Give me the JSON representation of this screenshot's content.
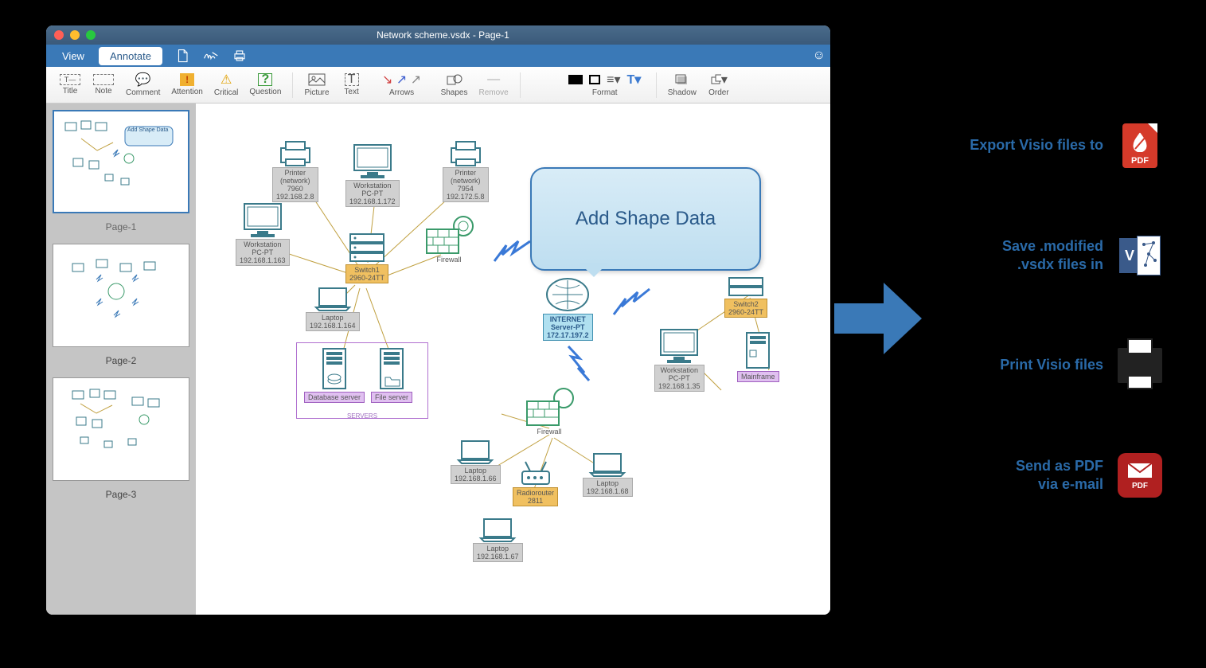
{
  "window": {
    "title": "Network scheme.vsdx - Page-1"
  },
  "menu": {
    "view": "View",
    "annotate": "Annotate"
  },
  "toolbar": {
    "title": "Title",
    "note": "Note",
    "comment": "Comment",
    "attention": "Attention",
    "critical": "Critical",
    "question": "Question",
    "picture": "Picture",
    "text": "Text",
    "arrows": "Arrows",
    "shapes": "Shapes",
    "remove": "Remove",
    "format": "Format",
    "shadow": "Shadow",
    "order": "Order"
  },
  "pages": {
    "p1": "Page-1",
    "p2": "Page-2",
    "p3": "Page-3",
    "mini_callout": "Add Shape Data"
  },
  "callout": "Add Shape Data",
  "nodes": {
    "printer1": "Printer\n(network)\n7960\n192.168.2.8",
    "workstation1": "Workstation\nPC-PT\n192.168.1.172",
    "printer2": "Printer\n(network)\n7954\n192.172.5.8",
    "workstation2": "Workstation\nPC-PT\n192.168.1.163",
    "switch1": "Switch1\n2960-24TT",
    "firewall1": "Firewall",
    "laptop1": "Laptop\n192.168.1.164",
    "dbserver": "Database server",
    "fileserver": "File server",
    "internet": "INTERNET\nServer-PT\n172.17.197.2",
    "switch2": "Switch2\n2960-24TT",
    "workstation3": "Workstation\nPC-PT\n192.168.1.35",
    "mainframe": "Mainframe",
    "firewall2": "Firewall",
    "laptop2": "Laptop\n192.168.1.66",
    "radiorouter": "Radiorouter\n2811",
    "laptop3": "Laptop\n192.168.1.68",
    "laptop4": "Laptop\n192.168.1.67"
  },
  "actions": {
    "export": "Export Visio files to",
    "save": "Save .modified .vsdx files in",
    "print": "Print Visio files",
    "send": "Send as PDF via e-mail",
    "pdf_badge": "PDF"
  }
}
